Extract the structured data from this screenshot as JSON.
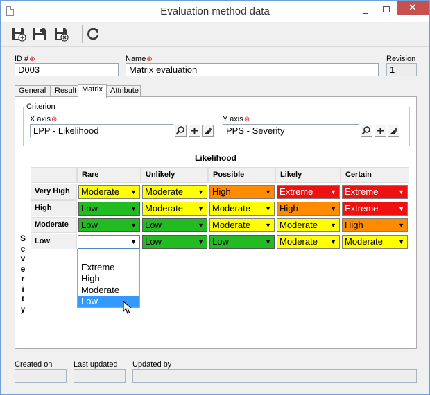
{
  "window": {
    "title": "Evaluation method data"
  },
  "colors": {
    "extreme": "#ee1111",
    "high": "#ff8c00",
    "moderate": "#ffff00",
    "low": "#22bb22",
    "selection": "#3399ff",
    "close": "#c75050"
  },
  "toolbar": {
    "buttons": [
      {
        "name": "save-new-icon"
      },
      {
        "name": "save-icon"
      },
      {
        "name": "save-close-icon"
      },
      {
        "name": "refresh-icon"
      }
    ]
  },
  "header": {
    "id_label": "ID #",
    "id_value": "D003",
    "name_label": "Name",
    "name_value": "Matrix evaluation",
    "revision_label": "Revision",
    "revision_value": "1"
  },
  "tabs": [
    "General",
    "Result",
    "Matrix",
    "Attribute"
  ],
  "active_tab": "Matrix",
  "criterion": {
    "legend": "Criterion",
    "x_label": "X axis",
    "x_value": "LPP - Likelihood",
    "y_label": "Y axis",
    "y_value": "PPS - Severity"
  },
  "matrix": {
    "x_title": "Likelihood",
    "y_title": "Severity",
    "columns": [
      "Rare",
      "Unlikely",
      "Possible",
      "Likely",
      "Certain"
    ],
    "rows": [
      {
        "label": "Very High",
        "cells": [
          "Moderate",
          "Moderate",
          "High",
          "Extreme",
          "Extreme"
        ]
      },
      {
        "label": "High",
        "cells": [
          "Low",
          "Moderate",
          "Moderate",
          "High",
          "Extreme"
        ]
      },
      {
        "label": "Moderate",
        "cells": [
          "Low",
          "Low",
          "Moderate",
          "Moderate",
          "High"
        ]
      },
      {
        "label": "Low",
        "cells": [
          "",
          "Low",
          "Low",
          "Moderate",
          "Moderate"
        ]
      }
    ],
    "dropdown_options": [
      "Extreme",
      "High",
      "Moderate",
      "Low"
    ],
    "dropdown_selected": "Low"
  },
  "footer": {
    "created_label": "Created on",
    "created_value": "",
    "updated_label": "Last updated",
    "updated_value": "",
    "updated_by_label": "Updated by",
    "updated_by_value": ""
  }
}
